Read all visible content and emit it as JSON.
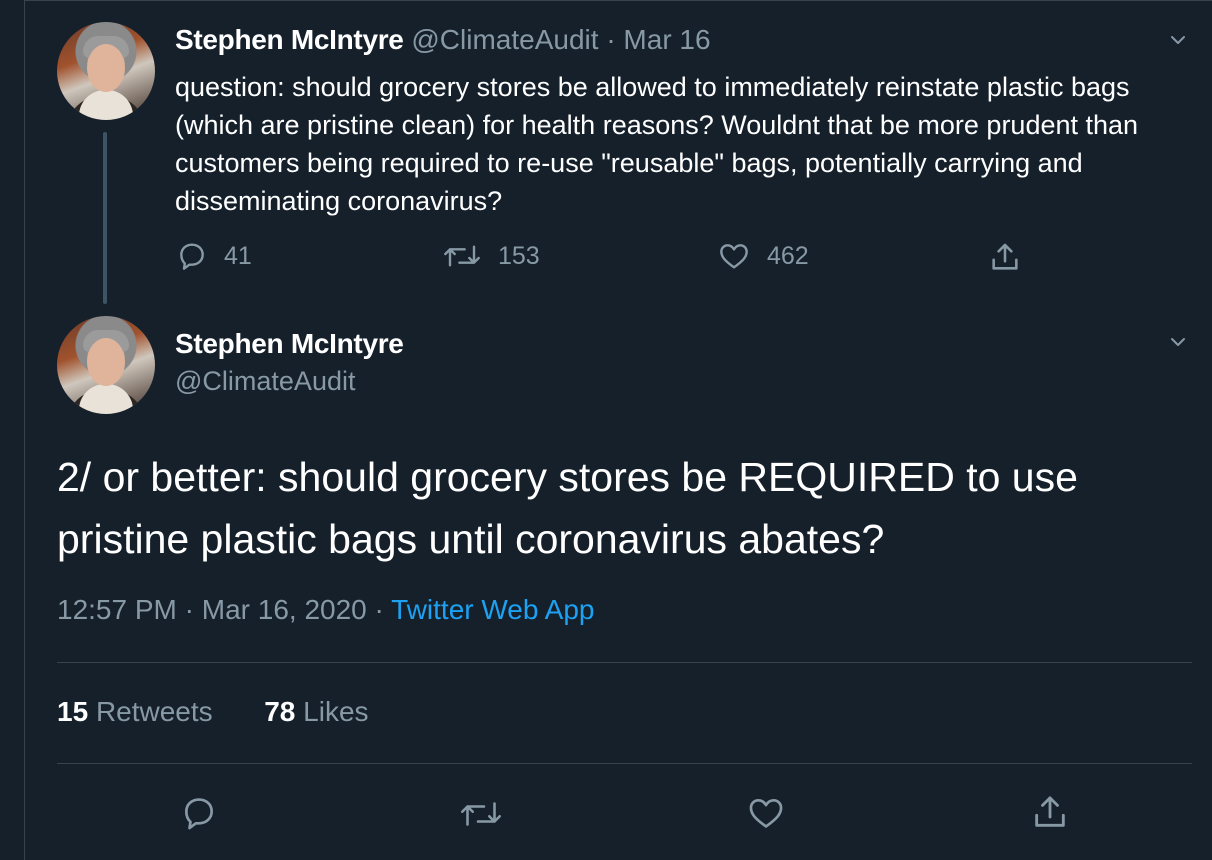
{
  "parent_tweet": {
    "author_name": "Stephen McIntyre",
    "handle": "@ClimateAudit",
    "separator": "·",
    "date": "Mar 16",
    "text": "question: should grocery stores be allowed to immediately reinstate plastic bags (which are pristine clean) for health reasons? Wouldnt that be more prudent  than customers being required to re-use \"reusable\" bags, potentially carrying and disseminating coronavirus?",
    "replies": "41",
    "retweets": "153",
    "likes": "462"
  },
  "main_tweet": {
    "author_name": "Stephen McIntyre",
    "handle": "@ClimateAudit",
    "text": "2/ or better: should grocery stores be REQUIRED to use pristine plastic bags until coronavirus abates?",
    "time": "12:57 PM",
    "separator": "·",
    "date": "Mar 16, 2020",
    "separator2": "·",
    "source": "Twitter Web App",
    "retweet_count": "15",
    "retweet_label": "Retweets",
    "like_count": "78",
    "like_label": "Likes"
  },
  "colors": {
    "background": "#15202b",
    "muted_text": "#8899a6",
    "link": "#1da1f2",
    "divider": "#38444d"
  },
  "icons": [
    "chevron-down-icon",
    "reply-icon",
    "retweet-icon",
    "like-icon",
    "share-icon"
  ]
}
